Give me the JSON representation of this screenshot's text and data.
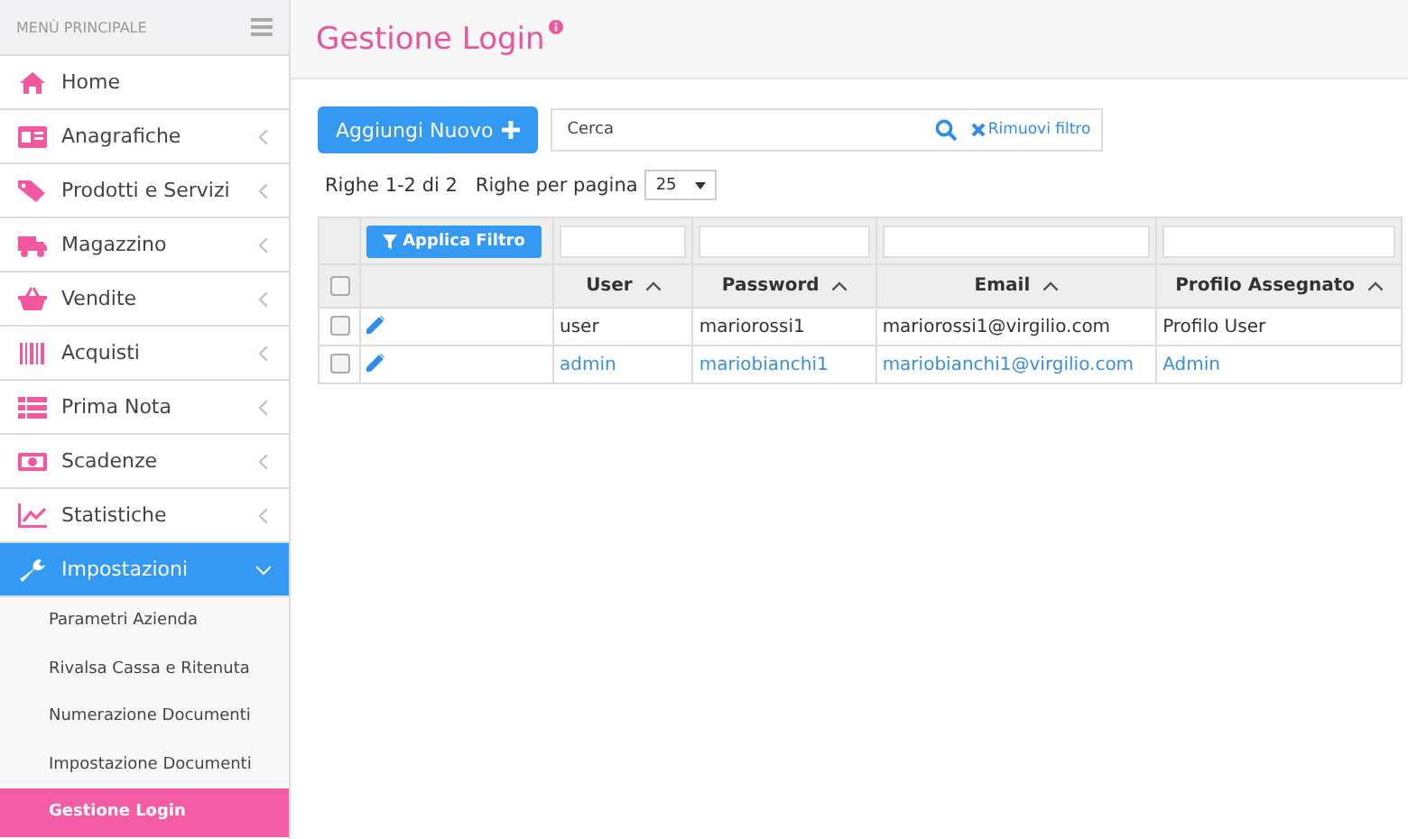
{
  "sidebar": {
    "header": "MENÙ PRINCIPALE",
    "items": [
      {
        "kind": "home",
        "label": "Home",
        "selected": false
      },
      {
        "kind": "card",
        "label": "Anagrafiche",
        "selected": false,
        "expanded": false
      },
      {
        "kind": "tag",
        "label": "Prodotti e Servizi",
        "selected": false,
        "expanded": false
      },
      {
        "kind": "truck",
        "label": "Magazzino",
        "selected": false,
        "expanded": false
      },
      {
        "kind": "basket",
        "label": "Vendite",
        "selected": false,
        "expanded": false
      },
      {
        "kind": "barcode",
        "label": "Acquisti",
        "selected": false,
        "expanded": false
      },
      {
        "kind": "list",
        "label": "Prima Nota",
        "selected": false,
        "expanded": false
      },
      {
        "kind": "money",
        "label": "Scadenze",
        "selected": false,
        "expanded": false
      },
      {
        "kind": "chart",
        "label": "Statistiche",
        "selected": false,
        "expanded": false
      },
      {
        "kind": "wrench",
        "label": "Impostazioni",
        "selected": true,
        "expanded": true,
        "children": [
          {
            "label": "Parametri Azienda",
            "selected": false
          },
          {
            "label": "Rivalsa Cassa e Ritenuta",
            "selected": false
          },
          {
            "label": "Numerazione Documenti",
            "selected": false
          },
          {
            "label": "Impostazione Documenti",
            "selected": false
          },
          {
            "label": "Gestione Login",
            "selected": true
          }
        ]
      }
    ]
  },
  "page": {
    "title": "Gestione Login"
  },
  "toolbar": {
    "add_button": "Aggiungi Nuovo",
    "search": {
      "placeholder": "Cerca"
    },
    "remove_filter": "Rimuovi filtro"
  },
  "pagination": {
    "rows_info": "Righe 1-2 di 2",
    "per_page_label": "Righe per pagina",
    "per_page_value": "25"
  },
  "table": {
    "filter_button": "Applica Filtro",
    "all_checked": false,
    "columns": [
      "User",
      "Password",
      "Email",
      "Profilo Assegnato"
    ],
    "rows": [
      {
        "checked": false,
        "highlighted": false,
        "cells": [
          "user",
          "mariorossi1",
          "mariorossi1@virgilio.com",
          "Profilo User"
        ]
      },
      {
        "checked": false,
        "highlighted": true,
        "cells": [
          "admin",
          "mariobianchi1",
          "mariobianchi1@virgilio.com",
          "Admin"
        ]
      }
    ]
  }
}
